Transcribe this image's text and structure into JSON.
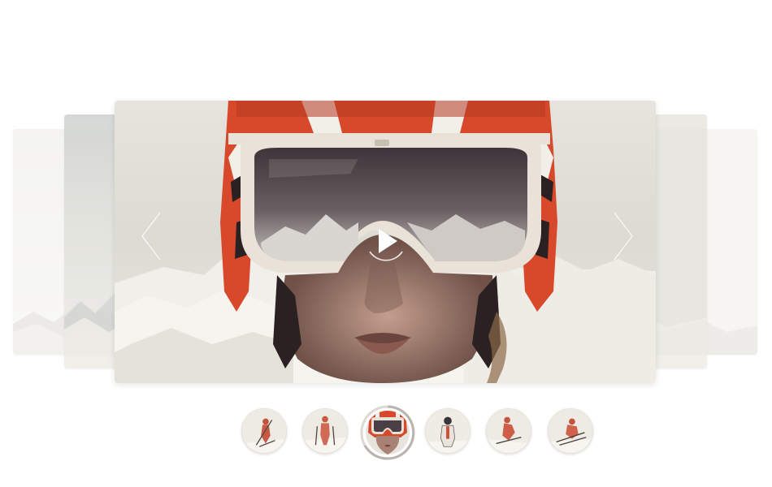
{
  "carousel": {
    "slide_count": 6,
    "active_index": 3,
    "accent_colors": {
      "helmet_red": "#d8492c",
      "sky": "#e9e7df",
      "snow": "#f4f2ec",
      "goggle_frame": "#e8e2d8",
      "goggle_lens": "#4a3f44",
      "progress_ring": "#c9c6c0"
    },
    "controls": {
      "prev_icon": "chevron-left-icon",
      "next_icon": "chevron-right-icon",
      "play_icon": "play-icon"
    },
    "thumbnails": [
      {
        "icon": "skier-pole-icon"
      },
      {
        "icon": "skier-standing-icon"
      },
      {
        "icon": "helmet-goggles-icon"
      },
      {
        "icon": "skier-frontal-icon"
      },
      {
        "icon": "skier-turning-icon"
      },
      {
        "icon": "skier-crouch-icon"
      }
    ]
  }
}
